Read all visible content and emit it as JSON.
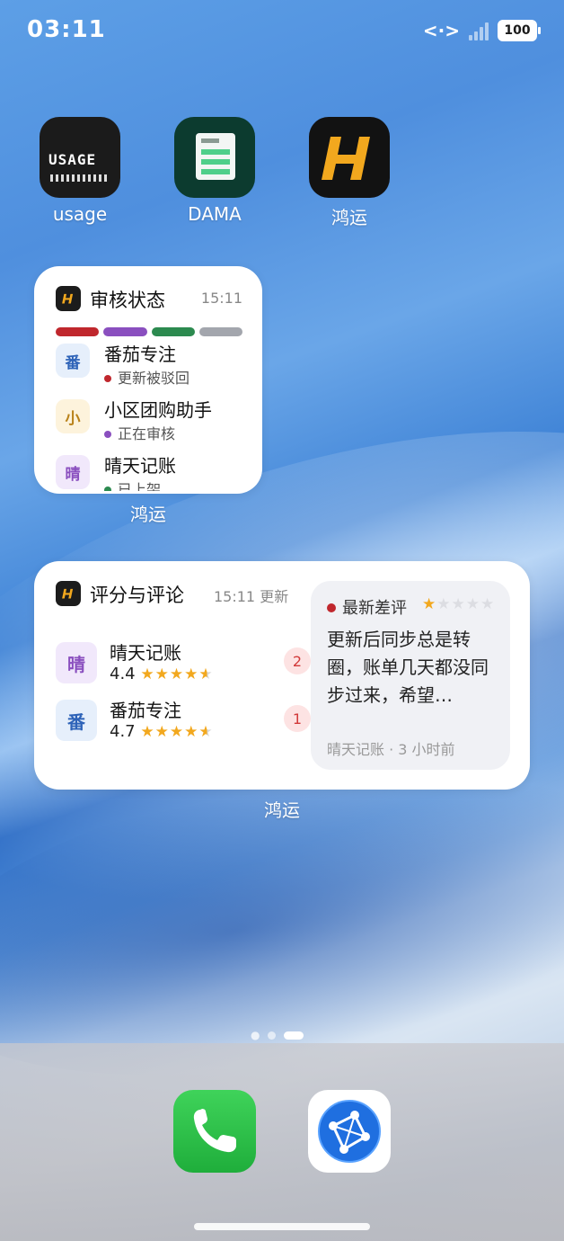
{
  "status_bar": {
    "time": "03:11",
    "battery": "100"
  },
  "apps": [
    {
      "label": "usage",
      "icon": "usage-icon",
      "icon_text": "USAGE"
    },
    {
      "label": "DAMA",
      "icon": "dama-icon"
    },
    {
      "label": "鸿运",
      "icon": "hongyun-icon"
    }
  ],
  "audit_widget": {
    "title": "审核状态",
    "time": "15:11",
    "bar_colors": [
      "#c0272d",
      "#8a4fbf",
      "#2c8a4f",
      "#a3a6ad"
    ],
    "items": [
      {
        "avatar": "番",
        "name": "番茄专注",
        "status": "更新被驳回",
        "dot_color": "#c0272d",
        "avatar_bg": "#e6effb",
        "avatar_fg": "#2e63b8"
      },
      {
        "avatar": "小",
        "name": "小区团购助手",
        "status": "正在审核",
        "dot_color": "#8a4fbf",
        "avatar_bg": "#fdf3dc",
        "avatar_fg": "#b9821a"
      },
      {
        "avatar": "晴",
        "name": "晴天记账",
        "status": "已上架",
        "dot_color": "#2c8a4f",
        "avatar_bg": "#f1e8fb",
        "avatar_fg": "#8a4fbf"
      }
    ],
    "widget_label": "鸿运"
  },
  "rating_widget": {
    "title": "评分与评论",
    "time": "15:11 更新",
    "items": [
      {
        "avatar": "晴",
        "name": "晴天记账",
        "rating": "4.4",
        "badge": "2",
        "avatar_bg": "#f1e8fb",
        "avatar_fg": "#8a4fbf"
      },
      {
        "avatar": "番",
        "name": "番茄专注",
        "rating": "4.7",
        "badge": "1",
        "avatar_bg": "#e6effb",
        "avatar_fg": "#2e63b8"
      }
    ],
    "review": {
      "heading": "最新差评",
      "stars": 1,
      "text": "更新后同步总是转圈，账单几天都没同步过来，希望…",
      "footer": "晴天记账 · 3 小时前"
    },
    "widget_label": "鸿运"
  },
  "dock": [
    {
      "name": "phone-app",
      "icon": "phone-icon"
    },
    {
      "name": "browser-app",
      "icon": "browser-icon"
    }
  ],
  "colors": {
    "phone_green": "#2fc24a",
    "browser_blue": "#1f6fe0",
    "accent_red": "#c0272d"
  }
}
